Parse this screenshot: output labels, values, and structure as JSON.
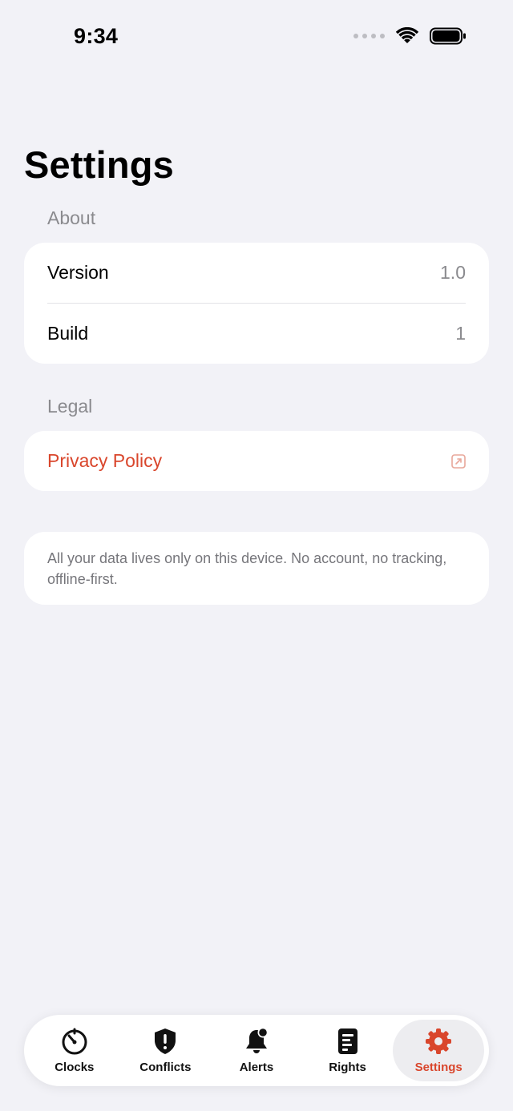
{
  "status_bar": {
    "time": "9:34"
  },
  "page": {
    "title": "Settings"
  },
  "about": {
    "header": "About",
    "rows": [
      {
        "label": "Version",
        "value": "1.0"
      },
      {
        "label": "Build",
        "value": "1"
      }
    ]
  },
  "legal": {
    "header": "Legal",
    "privacy_label": "Privacy Policy"
  },
  "note": {
    "text": "All your data lives only on this device. No account, no tracking, offline-first."
  },
  "tabbar": {
    "tabs": [
      {
        "label": "Clocks",
        "icon": "stopwatch-icon"
      },
      {
        "label": "Conflicts",
        "icon": "shield-exclamation-icon"
      },
      {
        "label": "Alerts",
        "icon": "bell-badge-icon"
      },
      {
        "label": "Rights",
        "icon": "document-list-icon"
      },
      {
        "label": "Settings",
        "icon": "gear-icon"
      }
    ],
    "active": "Settings"
  },
  "colors": {
    "accent": "#D9462C",
    "background": "#F2F2F7",
    "secondary_text": "#8A8A8E"
  }
}
